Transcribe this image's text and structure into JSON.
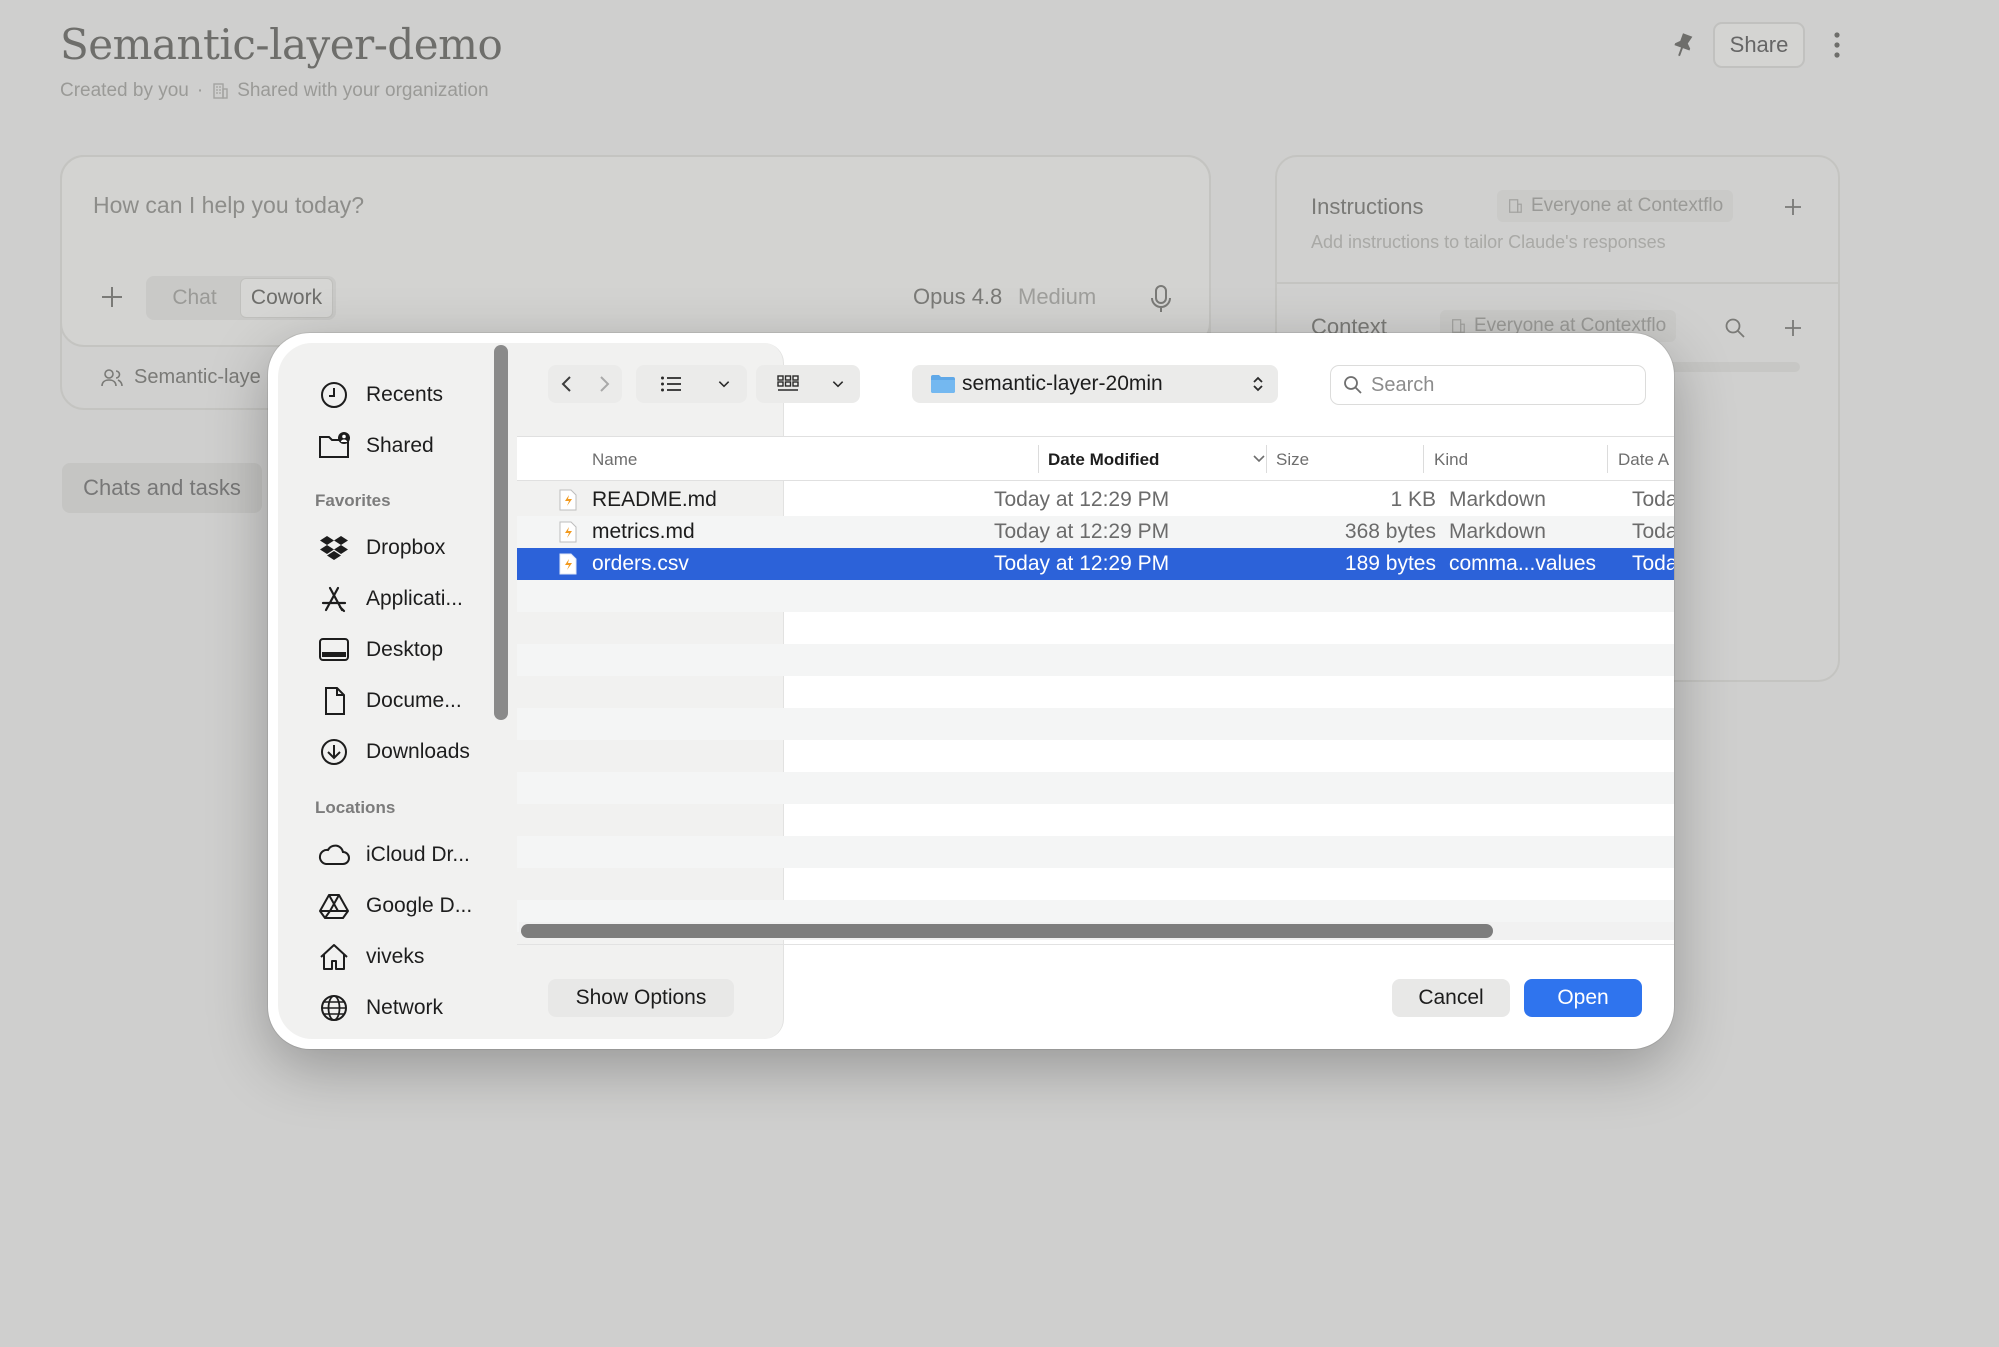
{
  "app": {
    "project_title": "Semantic-layer-demo",
    "created_by": "Created by you",
    "separator": "·",
    "sharing": "Shared with your organization",
    "share_label": "Share",
    "composer": {
      "placeholder": "How can I help you today?",
      "modes": [
        "Chat",
        "Cowork"
      ],
      "active_mode": "Cowork",
      "model": "Opus 4.8",
      "effort": "Medium"
    },
    "project_row_label": "Semantic-laye",
    "chats_tab_label": "Chats and tasks",
    "instructions": {
      "title": "Instructions",
      "scope": "Everyone at Contextflo",
      "description": "Add instructions to tailor Claude's responses"
    },
    "context": {
      "title": "Context",
      "scope": "Everyone at Contextflo"
    }
  },
  "dialog": {
    "sidebar": {
      "top_items": [
        {
          "label": "Recents",
          "icon": "clock-icon"
        },
        {
          "label": "Shared",
          "icon": "shared-folder-icon"
        }
      ],
      "favorites_heading": "Favorites",
      "favorites": [
        {
          "label": "Dropbox",
          "icon": "dropbox-icon"
        },
        {
          "label": "Applicati...",
          "icon": "applications-icon"
        },
        {
          "label": "Desktop",
          "icon": "desktop-icon"
        },
        {
          "label": "Docume...",
          "icon": "document-icon"
        },
        {
          "label": "Downloads",
          "icon": "download-icon"
        }
      ],
      "locations_heading": "Locations",
      "locations": [
        {
          "label": "iCloud Dr...",
          "icon": "cloud-icon"
        },
        {
          "label": "Google D...",
          "icon": "google-drive-icon"
        },
        {
          "label": "viveks",
          "icon": "home-icon"
        },
        {
          "label": "Network",
          "icon": "globe-icon"
        }
      ]
    },
    "current_folder": "semantic-layer-20min",
    "search_placeholder": "Search",
    "columns": {
      "name": "Name",
      "date_modified": "Date Modified",
      "size": "Size",
      "kind": "Kind",
      "date_added": "Date A"
    },
    "files": [
      {
        "name": "README.md",
        "date": "Today at 12:29 PM",
        "size": "1 KB",
        "kind": "Markdown",
        "added": "Today",
        "selected": false
      },
      {
        "name": "metrics.md",
        "date": "Today at 12:29 PM",
        "size": "368 bytes",
        "kind": "Markdown",
        "added": "Today",
        "selected": false
      },
      {
        "name": "orders.csv",
        "date": "Today at 12:29 PM",
        "size": "189 bytes",
        "kind": "comma...values",
        "added": "Today",
        "selected": true
      }
    ],
    "buttons": {
      "show_options": "Show Options",
      "cancel": "Cancel",
      "open": "Open"
    }
  },
  "colors": {
    "selection": "#2c62d9",
    "primary_button": "#2f74ee",
    "file_icon_accent": "#f29a1f"
  }
}
